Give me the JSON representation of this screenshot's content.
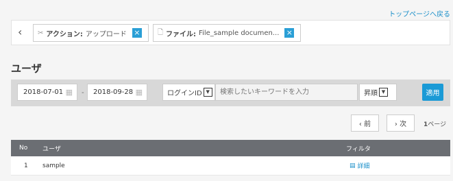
{
  "top_link": "トップページへ戻る",
  "filters": [
    {
      "icon": "tools-icon",
      "glyph": "✕",
      "key": "アクション:",
      "value": "アップロード",
      "close": "×"
    },
    {
      "icon": "document-icon",
      "glyph": "🗋",
      "key": "ファイル:",
      "value": "File_sample documen...",
      "close": "×"
    }
  ],
  "section_title": "ユーザ",
  "search": {
    "date_from": "2018-07-01",
    "date_sep": "-",
    "date_to": "2018-09-28",
    "field_select": "ログインID",
    "keyword_placeholder": "検索したいキーワードを入力",
    "order_select": "昇順",
    "apply_label": "適用"
  },
  "pagination": {
    "prev_label": "‹ 前",
    "next_label": "› 次",
    "page_number": "1",
    "page_suffix": "ページ"
  },
  "table": {
    "headers": {
      "no": "No",
      "user": "ユーザ",
      "filter": "フィルタ"
    },
    "rows": [
      {
        "no": "1",
        "user": "sample",
        "detail": "詳細"
      }
    ]
  }
}
